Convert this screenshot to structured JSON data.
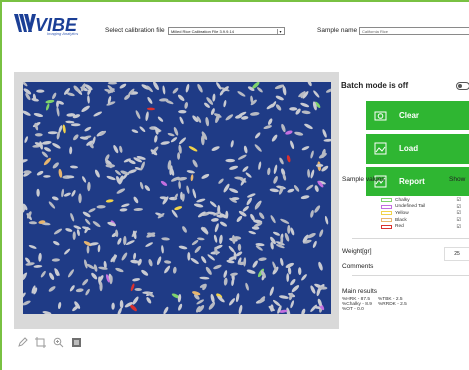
{
  "header": {
    "brand": "VIBE",
    "tagline": "Imaging Analytics",
    "calibration_label": "Select calibration file",
    "calibration_value": "Milled Rice Calibration File 3.9.9.14",
    "sample_name_label": "Sample name",
    "sample_name_value": "California Rice"
  },
  "panel": {
    "batch_mode": "Batch mode is off",
    "buttons": [
      {
        "label": "Clear",
        "icon": "camera-icon"
      },
      {
        "label": "Load",
        "icon": "image-icon"
      },
      {
        "label": "Report",
        "icon": "chart-icon"
      }
    ],
    "sample_values_label": "Sample values",
    "show_label": "Show",
    "legend": [
      {
        "label": "Chalky",
        "color": "#7fd36b"
      },
      {
        "label": "Undefined Tail",
        "color": "#c46fe0"
      },
      {
        "label": "Yellow",
        "color": "#f2d34a"
      },
      {
        "label": "Black",
        "color": "#e7b56e"
      },
      {
        "label": "Red",
        "color": "#d9312f"
      }
    ],
    "weight_label": "Weight[gr]",
    "weight_value": "25",
    "comments_label": "Comments",
    "main_results_label": "Main results",
    "results": [
      [
        "%HRK - 87.5",
        "%TBK - 2.5"
      ],
      [
        "%Chalky - 8.9",
        "%RRDK - 2.5"
      ],
      [
        "%OT - 0.0",
        ""
      ]
    ]
  },
  "tools": [
    "pencil-icon",
    "crop-icon",
    "zoom-icon",
    "image-icon"
  ]
}
